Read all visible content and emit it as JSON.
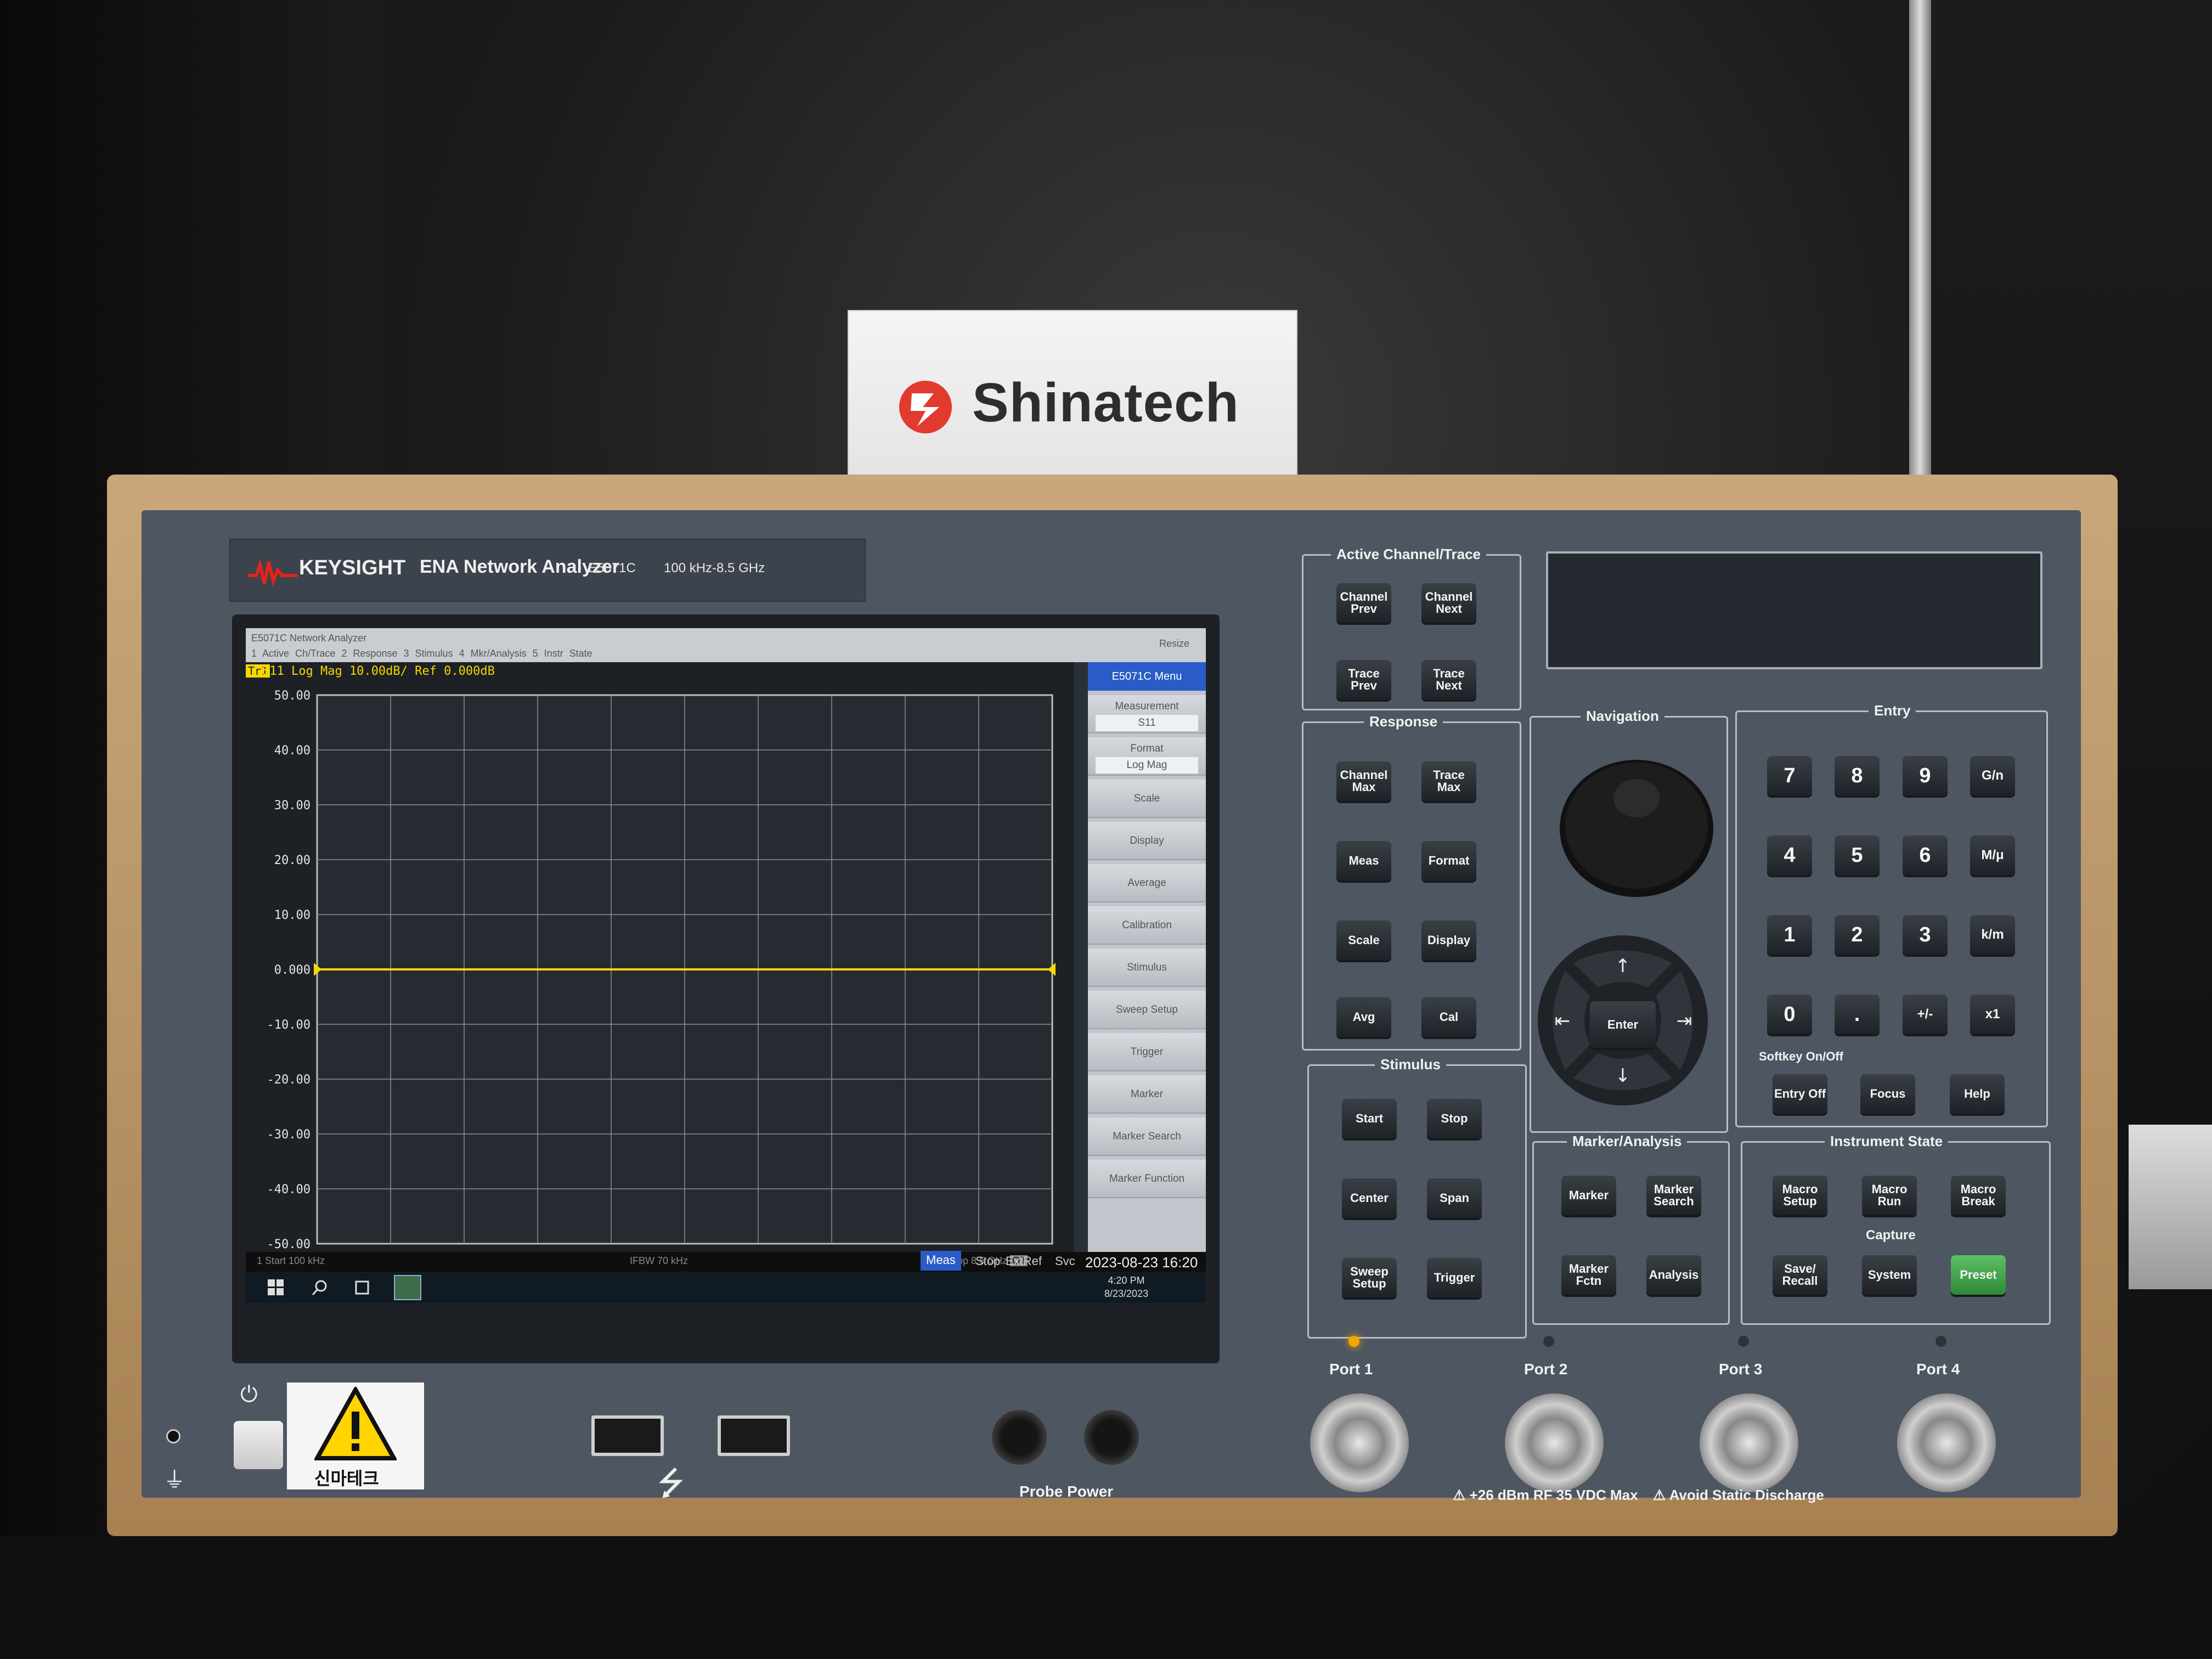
{
  "sign": {
    "brand": "Shinatech"
  },
  "instrument": {
    "brand": "KEYSIGHT",
    "model_name": "ENA Network Analyzer",
    "model_number": "E5071C",
    "freq_range": "100 kHz-8.5 GHz"
  },
  "screen": {
    "window_title": "E5071C Network Analyzer",
    "resize_label": "Resize",
    "menu_bar": [
      "1 Active Ch/Trace",
      "2 Response",
      "3 Stimulus",
      "4 Mkr/Analysis",
      "5 Instr State"
    ],
    "trace_badge": "Tr1",
    "trace_label": "S11 Log Mag 10.00dB/ Ref 0.000dB",
    "softkey_header": "E5071C Menu",
    "softkeys": [
      {
        "label": "Measurement",
        "value": "S11"
      },
      {
        "label": "Format",
        "value": "Log Mag"
      },
      {
        "label": "Scale"
      },
      {
        "label": "Display"
      },
      {
        "label": "Average"
      },
      {
        "label": "Calibration"
      },
      {
        "label": "Stimulus"
      },
      {
        "label": "Sweep Setup"
      },
      {
        "label": "Trigger"
      },
      {
        "label": "Marker"
      },
      {
        "label": "Marker Search"
      },
      {
        "label": "Marker Function"
      }
    ],
    "status_start": "1  Start 100 kHz",
    "status_ifbw": "IFBW 70 kHz",
    "status_stop": "Stop 8.5 GHz",
    "status_off": "Off",
    "status_meas": "Meas",
    "status_stop2": "Stop",
    "status_extref": "ExtRef",
    "status_svc": "Svc",
    "status_datetime": "2023-08-23 16:20",
    "taskbar_time": "4:20 PM",
    "taskbar_date": "8/23/2023"
  },
  "chart_data": {
    "type": "line",
    "title": "S11 Log Mag 10.00dB/ Ref 0.000dB",
    "y_ticks": [
      "50.00",
      "40.00",
      "30.00",
      "20.00",
      "10.00",
      "0.000",
      "-10.00",
      "-20.00",
      "-30.00",
      "-40.00",
      "-50.00"
    ],
    "ylim": [
      -50,
      50
    ],
    "x_start": "Start 100 kHz",
    "x_stop": "Stop 8.5 GHz",
    "grid": true,
    "series": [
      {
        "color": "#f5d800",
        "x": [
          0.0001,
          8.5
        ],
        "y": [
          0.0,
          0.0
        ]
      }
    ]
  },
  "panel": {
    "active_channel": {
      "title": "Active Channel/Trace",
      "keys": [
        "Channel Prev",
        "Channel Next",
        "Trace Prev",
        "Trace Next"
      ]
    },
    "response": {
      "title": "Response",
      "keys": [
        "Channel Max",
        "Trace Max",
        "Meas",
        "Format",
        "Scale",
        "Display",
        "Avg",
        "Cal"
      ]
    },
    "stimulus": {
      "title": "Stimulus",
      "keys": [
        "Start",
        "Stop",
        "Center",
        "Span",
        "Sweep Setup",
        "Trigger"
      ]
    },
    "navigation": {
      "title": "Navigation",
      "enter": "Enter"
    },
    "entry": {
      "title": "Entry",
      "keys": [
        "7",
        "8",
        "9",
        "G/n",
        "4",
        "5",
        "6",
        "M/μ",
        "1",
        "2",
        "3",
        "k/m",
        "0",
        ".",
        "+/-",
        "x1"
      ],
      "softkey_onoff": "Softkey On/Off",
      "bottom_keys": [
        "Entry Off",
        "Focus",
        "Help"
      ]
    },
    "marker_analysis": {
      "title": "Marker/Analysis",
      "keys": [
        "Marker",
        "Marker Search",
        "Marker Fctn",
        "Analysis"
      ]
    },
    "instrument_state": {
      "title": "Instrument State",
      "keys": [
        "Macro Setup",
        "Macro Run",
        "Macro Break"
      ],
      "capture": "Capture",
      "bottom_keys": [
        "Save/ Recall",
        "System",
        "Preset"
      ]
    },
    "ports": [
      "Port 1",
      "Port 2",
      "Port 3",
      "Port 4"
    ],
    "probe_power": "Probe Power",
    "port_warning": "+26 dBm RF  35 VDC Max",
    "static_warning": "Avoid Static Discharge",
    "sticker_text": "신마테크"
  },
  "colors": {
    "trace": "#f5d800",
    "preset": "#3fa34a",
    "softkey_header": "#2a5cc7"
  }
}
